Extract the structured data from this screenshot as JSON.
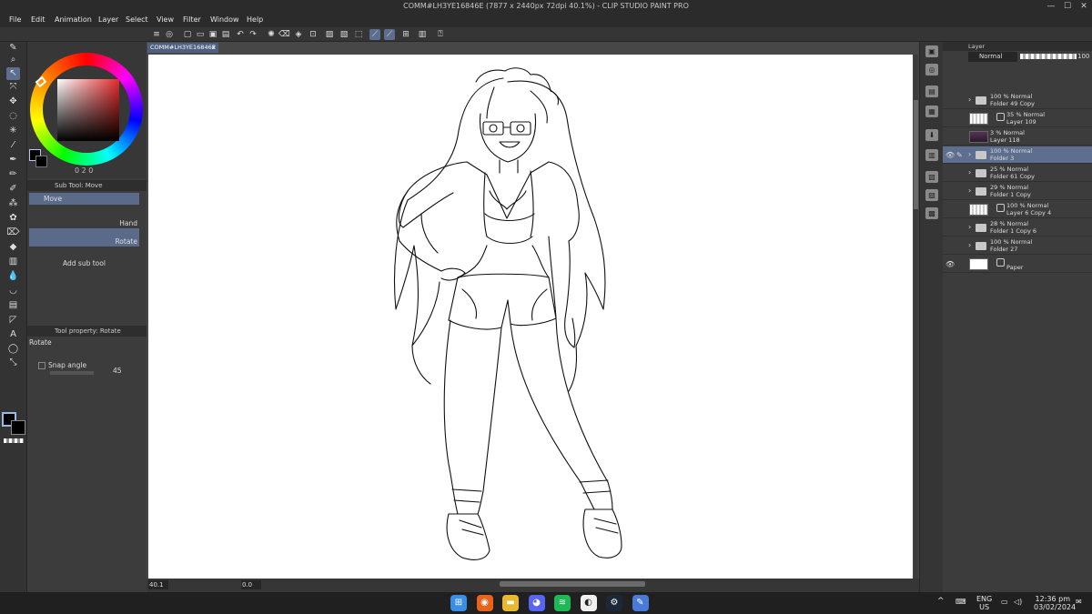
{
  "window": {
    "title": "COMM#LH3YE16846E (7877 x 2440px 72dpi 40.1%) - CLIP STUDIO PAINT PRO",
    "minimize": "—",
    "maximize": "☐",
    "close": "✕"
  },
  "menu": [
    "File",
    "Edit",
    "Animation",
    "Layer",
    "Select",
    "View",
    "Filter",
    "Window",
    "Help"
  ],
  "document_tab": {
    "label": "COMM#LH3YE16846E",
    "close": "x"
  },
  "color_wheel": {
    "foreground_color": "#000000",
    "background_color": "#000000",
    "hue_color": "#e52b2b",
    "values": "0  2  0"
  },
  "sub_tool_panel": {
    "title": "Sub Tool: Move",
    "items": [
      "Move",
      "Hand",
      "Rotate"
    ],
    "selected": "Rotate",
    "add_label": "Add sub tool"
  },
  "tool_property_panel": {
    "title": "Tool property: Rotate",
    "tool_name": "Rotate",
    "snap_label": "Snap angle",
    "snap_value": "45"
  },
  "status": {
    "zoom": "40.1",
    "angle": "0.0"
  },
  "layer_panel": {
    "title": "Layer",
    "blend_mode": "Normal",
    "opacity": "100",
    "layers": [
      {
        "opacity": "100 %",
        "mode": "Normal",
        "name": "Folder 49 Copy",
        "kind": "folder",
        "visible": false,
        "selected": false
      },
      {
        "opacity": "35 %",
        "mode": "Normal",
        "name": "Layer 109",
        "kind": "raster-checker",
        "visible": false,
        "selected": false
      },
      {
        "opacity": "3 %",
        "mode": "Normal",
        "name": "Layer 118",
        "kind": "raster-purple",
        "visible": false,
        "selected": false
      },
      {
        "opacity": "100 %",
        "mode": "Normal",
        "name": "Folder 3",
        "kind": "folder",
        "visible": true,
        "selected": true
      },
      {
        "opacity": "25 %",
        "mode": "Normal",
        "name": "Folder 61 Copy",
        "kind": "folder",
        "visible": false,
        "selected": false
      },
      {
        "opacity": "29 %",
        "mode": "Normal",
        "name": "Folder 1 Copy",
        "kind": "folder",
        "visible": false,
        "selected": false
      },
      {
        "opacity": "100 %",
        "mode": "Normal",
        "name": "Layer 6 Copy 4",
        "kind": "raster-checker",
        "visible": false,
        "selected": false
      },
      {
        "opacity": "28 %",
        "mode": "Normal",
        "name": "Folder 1 Copy 6",
        "kind": "folder",
        "visible": false,
        "selected": false
      },
      {
        "opacity": "100 %",
        "mode": "Normal",
        "name": "Folder 27",
        "kind": "folder",
        "visible": false,
        "selected": false
      },
      {
        "opacity": "",
        "mode": "",
        "name": "Paper",
        "kind": "paper",
        "visible": true,
        "selected": false
      }
    ]
  },
  "taskbar": {
    "apps": [
      {
        "icon": "windows-start-icon",
        "color": "#3a8ee6"
      },
      {
        "icon": "firefox-icon",
        "color": "#e8641c"
      },
      {
        "icon": "file-explorer-icon",
        "color": "#e8b830"
      },
      {
        "icon": "discord-icon",
        "color": "#5865f2"
      },
      {
        "icon": "spotify-icon",
        "color": "#1db954"
      },
      {
        "icon": "clip-studio-icon",
        "color": "#f0f0f0"
      },
      {
        "icon": "steam-icon",
        "color": "#1b2838"
      },
      {
        "icon": "clip-studio-paint-icon",
        "color": "#4a7ad8"
      }
    ],
    "language_top": "ENG",
    "language_bottom": "US",
    "time": "12:36 pm",
    "date": "03/02/2024"
  }
}
